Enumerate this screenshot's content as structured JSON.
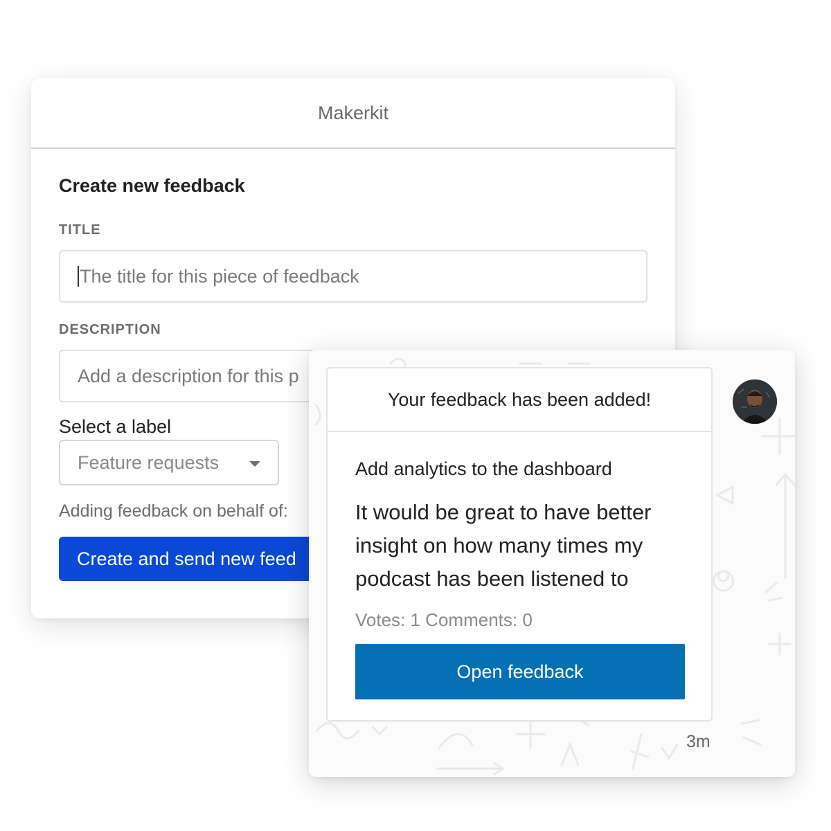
{
  "form_window": {
    "app_title": "Makerkit",
    "heading": "Create new feedback",
    "title_field": {
      "label": "TITLE",
      "placeholder": "The title for this piece of feedback"
    },
    "description_field": {
      "label": "DESCRIPTION",
      "placeholder": "Add a description for this p"
    },
    "label_select": {
      "label": "Select a label",
      "selected": "Feature requests",
      "icon": "chevron-down-icon"
    },
    "behalf_text": "Adding feedback on behalf of:",
    "submit_label": "Create and send new feed"
  },
  "notification": {
    "header": "Your feedback has been added!",
    "title": "Add analytics to the dashboard",
    "description": "It would be great to have better insight on how many times my podcast has been listened to",
    "stats": "Votes: 1 Comments: 0",
    "open_label": "Open feedback",
    "time": "3m",
    "avatar_icon": "user-avatar"
  },
  "colors": {
    "submit_button": "#0b48d6",
    "open_button": "#0670b5"
  }
}
